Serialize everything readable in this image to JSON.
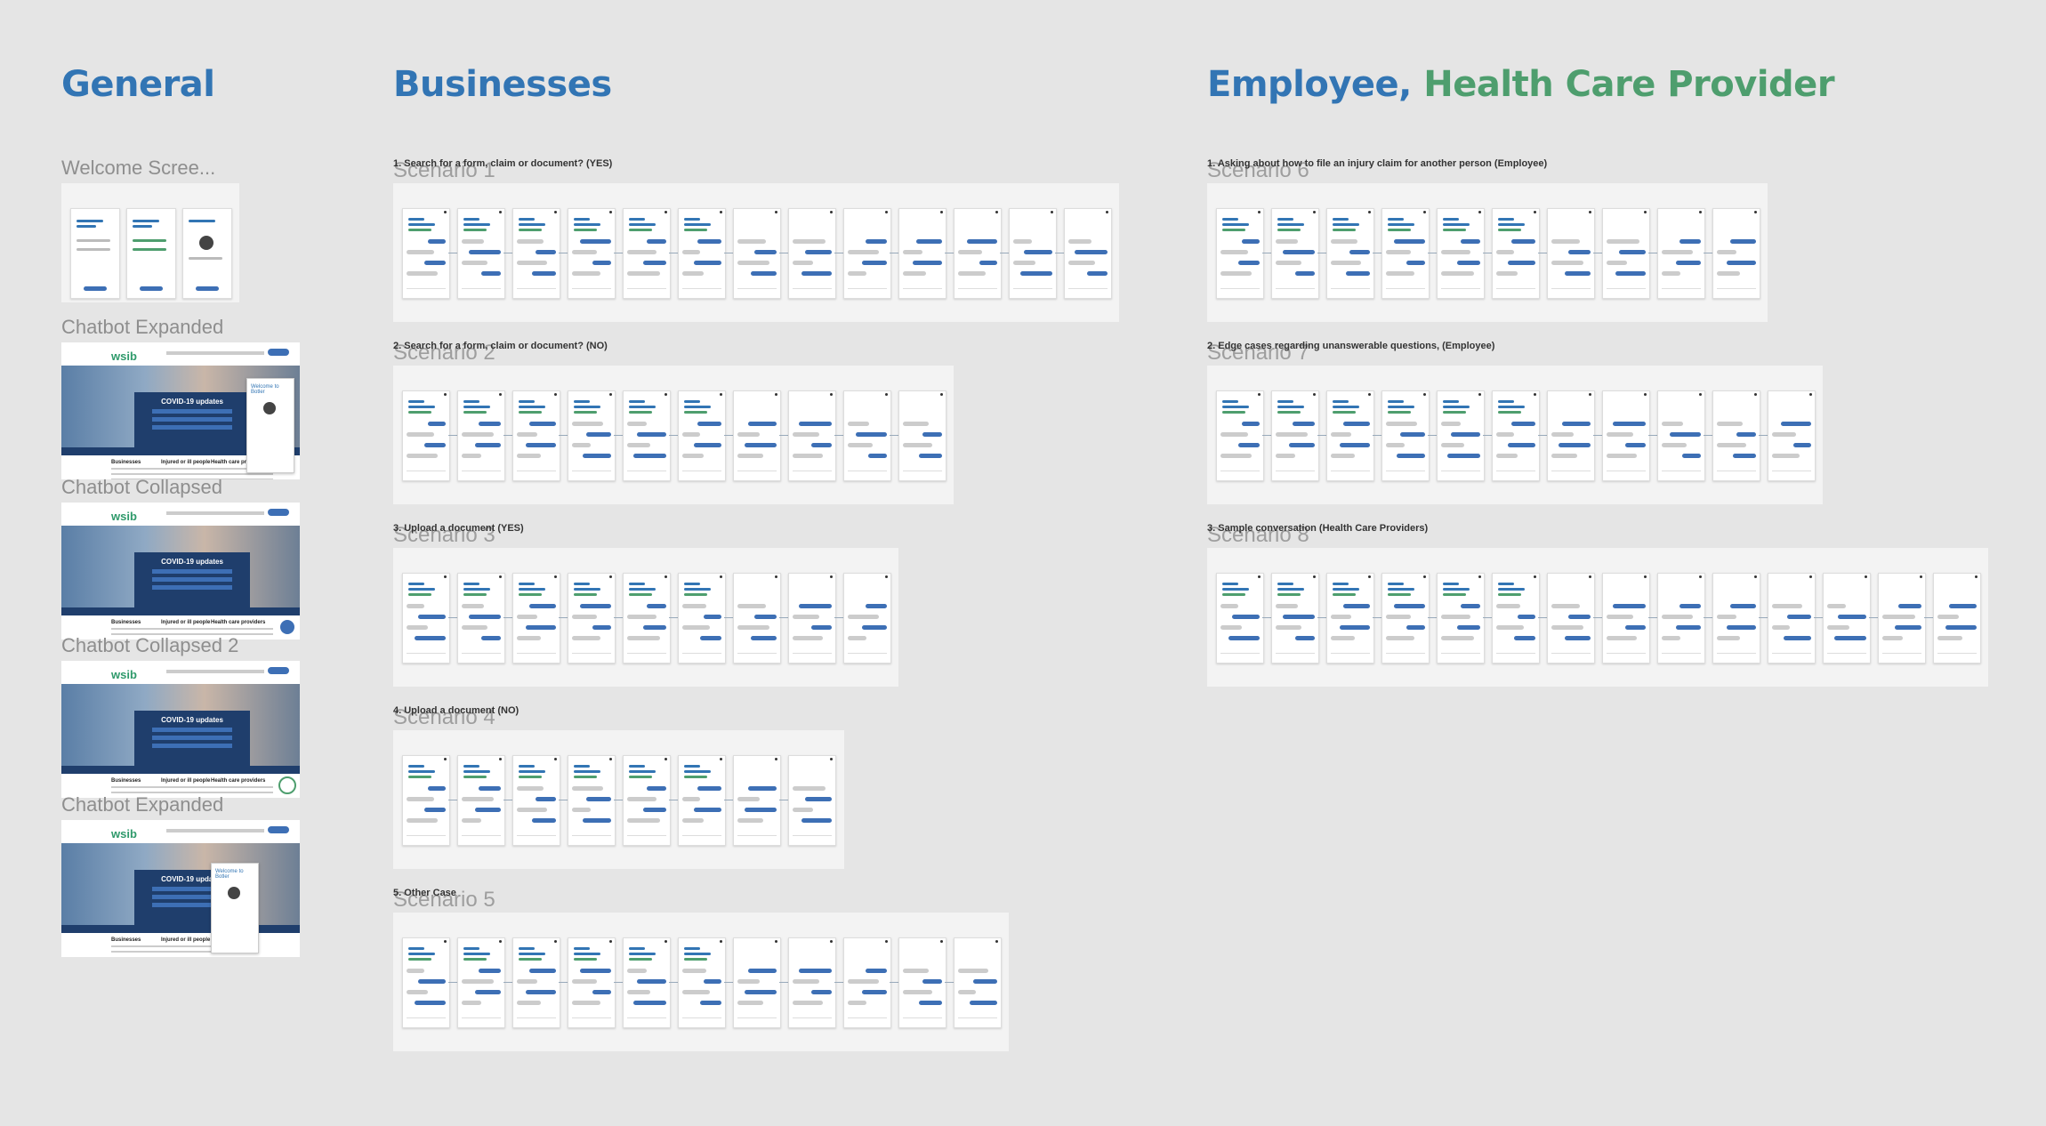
{
  "sections": {
    "general": "General",
    "businesses": "Businesses",
    "employee_part1": "Employee, ",
    "employee_part2": "Health Care Provider"
  },
  "colors": {
    "background": "#e5e5e5",
    "title_blue": "#3275b4",
    "title_green": "#4e9e6e",
    "accent_blue": "#3d6fb5",
    "navy": "#1f3e6c"
  },
  "general_frames": [
    {
      "label": "Welcome Scree..."
    },
    {
      "label": "Chatbot Expanded"
    },
    {
      "label": "Chatbot Collapsed"
    },
    {
      "label": "Chatbot Collapsed 2"
    },
    {
      "label": "Chatbot Expanded"
    }
  ],
  "site": {
    "logo": "wsib",
    "covid_title": "COVID-19 updates",
    "col1": "Businesses",
    "col2": "Injured or ill people",
    "col3": "Health care providers",
    "welcome": "Welcome to Botler"
  },
  "business_scenarios": [
    {
      "title": "Scenario 1",
      "subtitle": "1. Search for a form, claim or document? (YES)"
    },
    {
      "title": "Scenario 2",
      "subtitle": "2. Search for a form, claim or document? (NO)"
    },
    {
      "title": "Scenario 3",
      "subtitle": "3. Upload a document (YES)"
    },
    {
      "title": "Scenario 4",
      "subtitle": "4. Upload a document (NO)"
    },
    {
      "title": "Scenario 5",
      "subtitle": "5. Other Case"
    }
  ],
  "employee_scenarios": [
    {
      "title": "Scenario 6",
      "subtitle": "1. Asking about how to file an injury claim for another person (Employee)"
    },
    {
      "title": "Scenario 7",
      "subtitle": "2. Edge cases regarding unanswerable questions, (Employee)"
    },
    {
      "title": "Scenario 8",
      "subtitle": "3. Sample conversation (Health Care Providers)"
    }
  ]
}
